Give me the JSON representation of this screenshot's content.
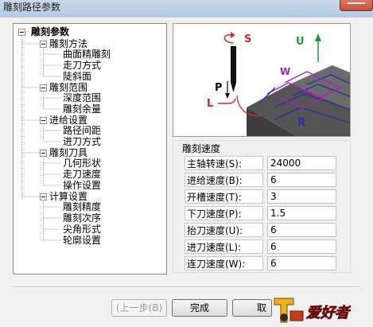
{
  "window": {
    "title": "雕刻路径参数"
  },
  "tree": {
    "root": "雕刻参数",
    "groups": [
      {
        "label": "雕刻方法",
        "children": [
          "曲面精雕刻",
          "走刀方式",
          "陡斜面"
        ]
      },
      {
        "label": "雕刻范围",
        "children": [
          "深度范围",
          "雕刻余量"
        ]
      },
      {
        "label": "进给设置",
        "children": [
          "路径间距",
          "进刀方式"
        ]
      },
      {
        "label": "雕刻刀具",
        "children": [
          "几何形状",
          "走刀速度",
          "操作设置"
        ]
      },
      {
        "label": "计算设置",
        "children": [
          "雕刻精度",
          "雕刻次序",
          "尖角形式",
          "轮廓设置"
        ]
      }
    ]
  },
  "preview": {
    "labels": {
      "S": "S",
      "U": "U",
      "W": "W",
      "P": "P",
      "L": "L",
      "R": "R"
    }
  },
  "speed": {
    "title": "雕刻速度",
    "rows": [
      {
        "label": "主轴转速(S):",
        "value": "24000"
      },
      {
        "label": "进给速度(B):",
        "value": "6"
      },
      {
        "label": "开槽速度(T):",
        "value": "3"
      },
      {
        "label": "下刀速度(P):",
        "value": "1.5"
      },
      {
        "label": "抬刀速度(U):",
        "value": "6"
      },
      {
        "label": "进刀速度(L):",
        "value": "6"
      },
      {
        "label": "连刀速度(W):",
        "value": "6"
      }
    ]
  },
  "buttons": {
    "prev": "(上一步(B)",
    "finish": "完成",
    "cancel": "取"
  },
  "logo": {
    "text": "爱好者"
  },
  "colors": {
    "title_bg": "#c9d9ec",
    "accent_red": "#d62a2a",
    "accent_blue": "#2830a0",
    "accent_green": "#1a9a3a",
    "accent_purple": "#b01cc0"
  }
}
